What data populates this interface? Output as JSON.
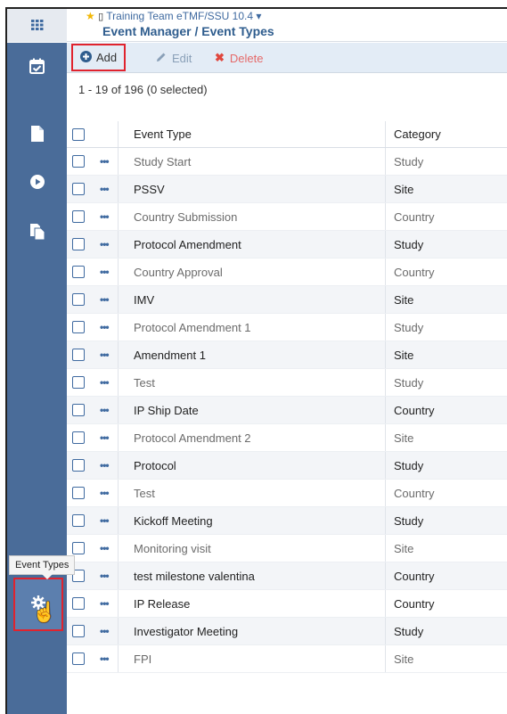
{
  "header": {
    "apps_icon": "grid-icon",
    "star_icon": "star",
    "breadcrumb": "Training Team eTMF/SSU 10.4",
    "breadcrumb_caret": "▾",
    "page_title": "Event Manager / Event Types"
  },
  "sidebar": {
    "items": [
      {
        "icon": "calendar-check-icon"
      },
      {
        "icon": "file-icon"
      },
      {
        "icon": "play-circle-icon"
      },
      {
        "icon": "copy-document-icon"
      }
    ],
    "settings_icon": "gear-icon",
    "tooltip": "Event Types"
  },
  "toolbar": {
    "add_label": "Add",
    "edit_label": "Edit",
    "delete_label": "Delete"
  },
  "grid": {
    "count_text": "1 - 19 of 196 (0 selected)",
    "columns": [
      "Event Type",
      "Category"
    ],
    "rows": [
      {
        "type": "Study Start",
        "category": "Study"
      },
      {
        "type": "PSSV",
        "category": "Site"
      },
      {
        "type": "Country Submission",
        "category": "Country"
      },
      {
        "type": "Protocol Amendment",
        "category": "Study"
      },
      {
        "type": "Country Approval",
        "category": "Country"
      },
      {
        "type": "IMV",
        "category": "Site"
      },
      {
        "type": "Protocol Amendment 1",
        "category": "Study"
      },
      {
        "type": "Amendment 1",
        "category": "Site"
      },
      {
        "type": "Test",
        "category": "Study"
      },
      {
        "type": "IP Ship Date",
        "category": "Country"
      },
      {
        "type": "Protocol Amendment 2",
        "category": "Site"
      },
      {
        "type": "Protocol",
        "category": "Study"
      },
      {
        "type": "Test",
        "category": "Country"
      },
      {
        "type": "Kickoff Meeting",
        "category": "Study"
      },
      {
        "type": "Monitoring visit",
        "category": "Site"
      },
      {
        "type": "test milestone valentina",
        "category": "Country"
      },
      {
        "type": "IP Release",
        "category": "Country"
      },
      {
        "type": "Investigator Meeting",
        "category": "Study"
      },
      {
        "type": "FPI",
        "category": "Site"
      }
    ]
  }
}
